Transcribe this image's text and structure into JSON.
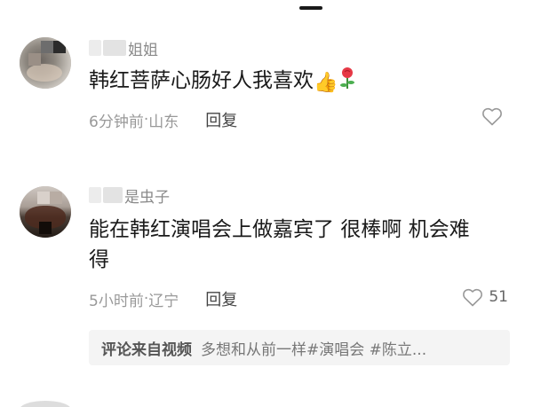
{
  "comments": [
    {
      "username": "姐姐",
      "text": "韩红菩萨心肠好人我喜欢",
      "emojis": [
        "thumbs-up",
        "rose"
      ],
      "time": "6分钟前",
      "location": "山东",
      "reply_label": "回复",
      "likes": ""
    },
    {
      "username": "是虫子",
      "text_line1": "能在韩红演唱会上做嘉宾了 很棒啊 机会难",
      "text_line2": "得",
      "time": "5小时前",
      "location": "辽宁",
      "reply_label": "回复",
      "likes": "51"
    }
  ],
  "source_bar": {
    "label": "评论来自视频",
    "text": "多想和从前一样#演唱会 #陈立..."
  },
  "separator": "·",
  "colors": {
    "like_outline": "#999999",
    "thumb": "#f3a21b",
    "rose": "#e63946"
  }
}
